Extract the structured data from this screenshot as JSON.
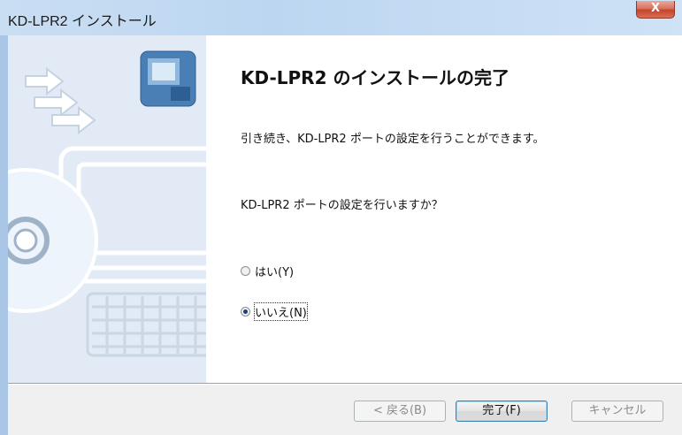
{
  "window": {
    "title": "KD-LPR2 インストール",
    "close_label": "X"
  },
  "content": {
    "heading": "KD-LPR2 のインストールの完了",
    "description": "引き続き、KD-LPR2 ポートの設定を行うことができます。",
    "question": "KD-LPR2 ポートの設定を行いますか？",
    "options": [
      {
        "label": "はい(Y)",
        "checked": false
      },
      {
        "label": "いいえ(N)",
        "checked": true
      }
    ]
  },
  "buttons": {
    "back": "< 戻る(B)",
    "finish": "完了(F)",
    "cancel": "キャンセル"
  }
}
